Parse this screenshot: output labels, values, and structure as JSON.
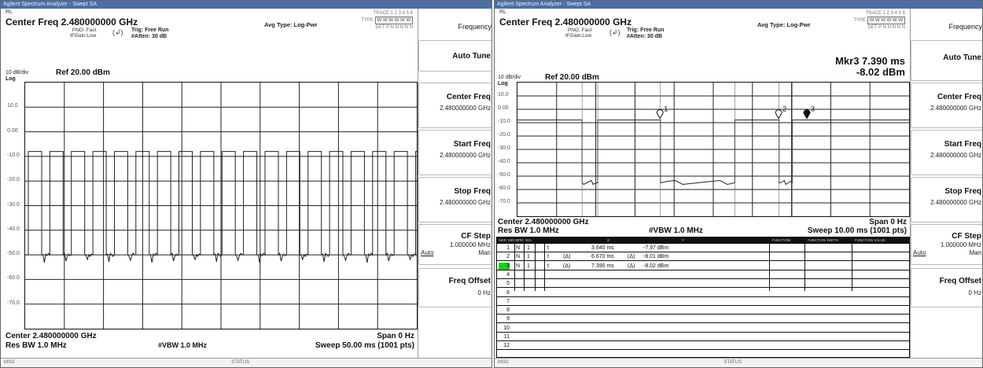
{
  "left": {
    "title_bar": "Agilent Spectrum Analyzer - Swept SA",
    "rl": "RL",
    "header": {
      "center_freq": "Center Freq 2.480000000 GHz",
      "pno_line1": "PNO: Fast",
      "pno_line2": "IFGain:Low",
      "trig_line1": "Trig: Free Run",
      "trig_line2": "#Atten: 30 dB",
      "avg_type": "Avg Type: Log-Pwr",
      "trace_line1": "TRACE 1 2 3 4 5 6",
      "trace_line2": "TYPE",
      "trace_line3": "DET P N N N N N"
    },
    "scale": "10 dB/div",
    "scale_type": "Log",
    "ref": "Ref 20.00 dBm",
    "y_labels": [
      "10.0",
      "0.00",
      "-10.0",
      "-20.0",
      "-30.0",
      "-40.0",
      "-50.0",
      "-60.0",
      "-70.0"
    ],
    "footer": {
      "center": "Center 2.480000000 GHz",
      "res_bw": "Res BW 1.0 MHz",
      "vbw": "#VBW 1.0 MHz",
      "span": "Span 0 Hz",
      "sweep": "Sweep 50.00 ms (1001 pts)"
    },
    "status": {
      "msg": "MSG",
      "status": "STATUS"
    },
    "softkeys": {
      "menu_title": "Frequency",
      "auto_tune": "Auto Tune",
      "center_freq": {
        "label": "Center Freq",
        "value": "2.480000000 GHz"
      },
      "start_freq": {
        "label": "Start Freq",
        "value": "2.480000000 GHz"
      },
      "stop_freq": {
        "label": "Stop Freq",
        "value": "2.480000000 GHz"
      },
      "cf_step": {
        "label": "CF Step",
        "value": "1.000000 MHz",
        "auto": "Auto",
        "man": "Man"
      },
      "freq_offset": {
        "label": "Freq Offset",
        "value": "0 Hz"
      }
    }
  },
  "right": {
    "title_bar": "Agilent Spectrum Analyzer - Swept SA",
    "rl": "RL",
    "header": {
      "center_freq": "Center Freq 2.480000000 GHz",
      "pno_line1": "PNO: Fast",
      "pno_line2": "IFGain:Low",
      "trig_line1": "Trig: Free Run",
      "trig_line2": "#Atten: 30 dB",
      "avg_type": "Avg Type: Log-Pwr",
      "trace_line1": "TRACE 1 2 3 4 5 6",
      "trace_line2": "TYPE",
      "trace_line3": "DET P N N N N N"
    },
    "marker_readout": {
      "line1": "Mkr3 7.390 ms",
      "line2": "-8.02 dBm"
    },
    "scale": "10 dB/div",
    "scale_type": "Log",
    "ref": "Ref 20.00 dBm",
    "y_labels": [
      "10.0",
      "0.00",
      "-10.0",
      "-20.0",
      "-30.0",
      "-40.0",
      "-50.0",
      "-60.0",
      "-70.0"
    ],
    "markers": [
      {
        "label": "1",
        "time_ms": 3.64,
        "level_dbm": -7.97
      },
      {
        "label": "2",
        "time_ms": 6.67,
        "level_dbm": -8.01
      },
      {
        "label": "3",
        "time_ms": 7.39,
        "level_dbm": -8.02
      }
    ],
    "footer": {
      "center": "Center 2.480000000 GHz",
      "res_bw": "Res BW 1.0 MHz",
      "vbw": "#VBW 1.0 MHz",
      "span": "Span 0 Hz",
      "sweep": "Sweep 10.00 ms (1001 pts)"
    },
    "marker_table": {
      "headers": [
        "MKR",
        "MODE",
        "TRC",
        "SCL",
        "X",
        "Y",
        "FUNCTION",
        "FUNCTION WIDTH",
        "FUNCTION VALUE"
      ],
      "rows": [
        {
          "n": "1",
          "mode": "N",
          "trc": "1",
          "scl": "t",
          "delta": "",
          "x": "3.640 ms",
          "ydelta": "",
          "y": "-7.97 dBm"
        },
        {
          "n": "2",
          "mode": "N",
          "trc": "1",
          "scl": "t",
          "delta": "(Δ)",
          "x": "6.670 ms",
          "ydelta": "(Δ)",
          "y": "-8.01 dBm"
        },
        {
          "n": "3",
          "mode": "N",
          "trc": "1",
          "scl": "t",
          "delta": "(Δ)",
          "x": "7.390 ms",
          "ydelta": "(Δ)",
          "y": "-8.02 dBm"
        },
        {
          "n": "4"
        },
        {
          "n": "5"
        },
        {
          "n": "6"
        },
        {
          "n": "7"
        },
        {
          "n": "8"
        },
        {
          "n": "9"
        },
        {
          "n": "10"
        },
        {
          "n": "11"
        },
        {
          "n": "12"
        }
      ]
    },
    "status": {
      "msg": "MSG",
      "status": "STATUS"
    },
    "softkeys": {
      "menu_title": "Frequency",
      "auto_tune": "Auto Tune",
      "center_freq": {
        "label": "Center Freq",
        "value": "2.480000000 GHz"
      },
      "start_freq": {
        "label": "Start Freq",
        "value": "2.480000000 GHz"
      },
      "stop_freq": {
        "label": "Stop Freq",
        "value": "2.480000000 GHz"
      },
      "cf_step": {
        "label": "CF Step",
        "value": "1.000000 MHz",
        "auto": "Auto",
        "man": "Man"
      },
      "freq_offset": {
        "label": "Freq Offset",
        "value": "0 Hz"
      }
    }
  },
  "colors": {
    "title_bar": "#4a6fa8",
    "trace": "#222222",
    "grid": "#111111",
    "selected_row": "#19d019"
  }
}
